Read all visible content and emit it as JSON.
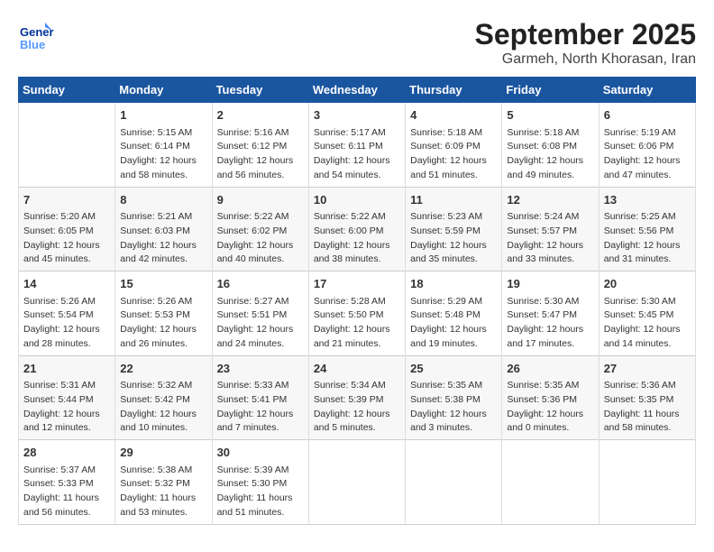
{
  "header": {
    "logo_line1": "General",
    "logo_line2": "Blue",
    "month": "September 2025",
    "location": "Garmeh, North Khorasan, Iran"
  },
  "weekdays": [
    "Sunday",
    "Monday",
    "Tuesday",
    "Wednesday",
    "Thursday",
    "Friday",
    "Saturday"
  ],
  "weeks": [
    [
      {
        "day": "",
        "info": ""
      },
      {
        "day": "1",
        "info": "Sunrise: 5:15 AM\nSunset: 6:14 PM\nDaylight: 12 hours\nand 58 minutes."
      },
      {
        "day": "2",
        "info": "Sunrise: 5:16 AM\nSunset: 6:12 PM\nDaylight: 12 hours\nand 56 minutes."
      },
      {
        "day": "3",
        "info": "Sunrise: 5:17 AM\nSunset: 6:11 PM\nDaylight: 12 hours\nand 54 minutes."
      },
      {
        "day": "4",
        "info": "Sunrise: 5:18 AM\nSunset: 6:09 PM\nDaylight: 12 hours\nand 51 minutes."
      },
      {
        "day": "5",
        "info": "Sunrise: 5:18 AM\nSunset: 6:08 PM\nDaylight: 12 hours\nand 49 minutes."
      },
      {
        "day": "6",
        "info": "Sunrise: 5:19 AM\nSunset: 6:06 PM\nDaylight: 12 hours\nand 47 minutes."
      }
    ],
    [
      {
        "day": "7",
        "info": "Sunrise: 5:20 AM\nSunset: 6:05 PM\nDaylight: 12 hours\nand 45 minutes."
      },
      {
        "day": "8",
        "info": "Sunrise: 5:21 AM\nSunset: 6:03 PM\nDaylight: 12 hours\nand 42 minutes."
      },
      {
        "day": "9",
        "info": "Sunrise: 5:22 AM\nSunset: 6:02 PM\nDaylight: 12 hours\nand 40 minutes."
      },
      {
        "day": "10",
        "info": "Sunrise: 5:22 AM\nSunset: 6:00 PM\nDaylight: 12 hours\nand 38 minutes."
      },
      {
        "day": "11",
        "info": "Sunrise: 5:23 AM\nSunset: 5:59 PM\nDaylight: 12 hours\nand 35 minutes."
      },
      {
        "day": "12",
        "info": "Sunrise: 5:24 AM\nSunset: 5:57 PM\nDaylight: 12 hours\nand 33 minutes."
      },
      {
        "day": "13",
        "info": "Sunrise: 5:25 AM\nSunset: 5:56 PM\nDaylight: 12 hours\nand 31 minutes."
      }
    ],
    [
      {
        "day": "14",
        "info": "Sunrise: 5:26 AM\nSunset: 5:54 PM\nDaylight: 12 hours\nand 28 minutes."
      },
      {
        "day": "15",
        "info": "Sunrise: 5:26 AM\nSunset: 5:53 PM\nDaylight: 12 hours\nand 26 minutes."
      },
      {
        "day": "16",
        "info": "Sunrise: 5:27 AM\nSunset: 5:51 PM\nDaylight: 12 hours\nand 24 minutes."
      },
      {
        "day": "17",
        "info": "Sunrise: 5:28 AM\nSunset: 5:50 PM\nDaylight: 12 hours\nand 21 minutes."
      },
      {
        "day": "18",
        "info": "Sunrise: 5:29 AM\nSunset: 5:48 PM\nDaylight: 12 hours\nand 19 minutes."
      },
      {
        "day": "19",
        "info": "Sunrise: 5:30 AM\nSunset: 5:47 PM\nDaylight: 12 hours\nand 17 minutes."
      },
      {
        "day": "20",
        "info": "Sunrise: 5:30 AM\nSunset: 5:45 PM\nDaylight: 12 hours\nand 14 minutes."
      }
    ],
    [
      {
        "day": "21",
        "info": "Sunrise: 5:31 AM\nSunset: 5:44 PM\nDaylight: 12 hours\nand 12 minutes."
      },
      {
        "day": "22",
        "info": "Sunrise: 5:32 AM\nSunset: 5:42 PM\nDaylight: 12 hours\nand 10 minutes."
      },
      {
        "day": "23",
        "info": "Sunrise: 5:33 AM\nSunset: 5:41 PM\nDaylight: 12 hours\nand 7 minutes."
      },
      {
        "day": "24",
        "info": "Sunrise: 5:34 AM\nSunset: 5:39 PM\nDaylight: 12 hours\nand 5 minutes."
      },
      {
        "day": "25",
        "info": "Sunrise: 5:35 AM\nSunset: 5:38 PM\nDaylight: 12 hours\nand 3 minutes."
      },
      {
        "day": "26",
        "info": "Sunrise: 5:35 AM\nSunset: 5:36 PM\nDaylight: 12 hours\nand 0 minutes."
      },
      {
        "day": "27",
        "info": "Sunrise: 5:36 AM\nSunset: 5:35 PM\nDaylight: 11 hours\nand 58 minutes."
      }
    ],
    [
      {
        "day": "28",
        "info": "Sunrise: 5:37 AM\nSunset: 5:33 PM\nDaylight: 11 hours\nand 56 minutes."
      },
      {
        "day": "29",
        "info": "Sunrise: 5:38 AM\nSunset: 5:32 PM\nDaylight: 11 hours\nand 53 minutes."
      },
      {
        "day": "30",
        "info": "Sunrise: 5:39 AM\nSunset: 5:30 PM\nDaylight: 11 hours\nand 51 minutes."
      },
      {
        "day": "",
        "info": ""
      },
      {
        "day": "",
        "info": ""
      },
      {
        "day": "",
        "info": ""
      },
      {
        "day": "",
        "info": ""
      }
    ]
  ]
}
